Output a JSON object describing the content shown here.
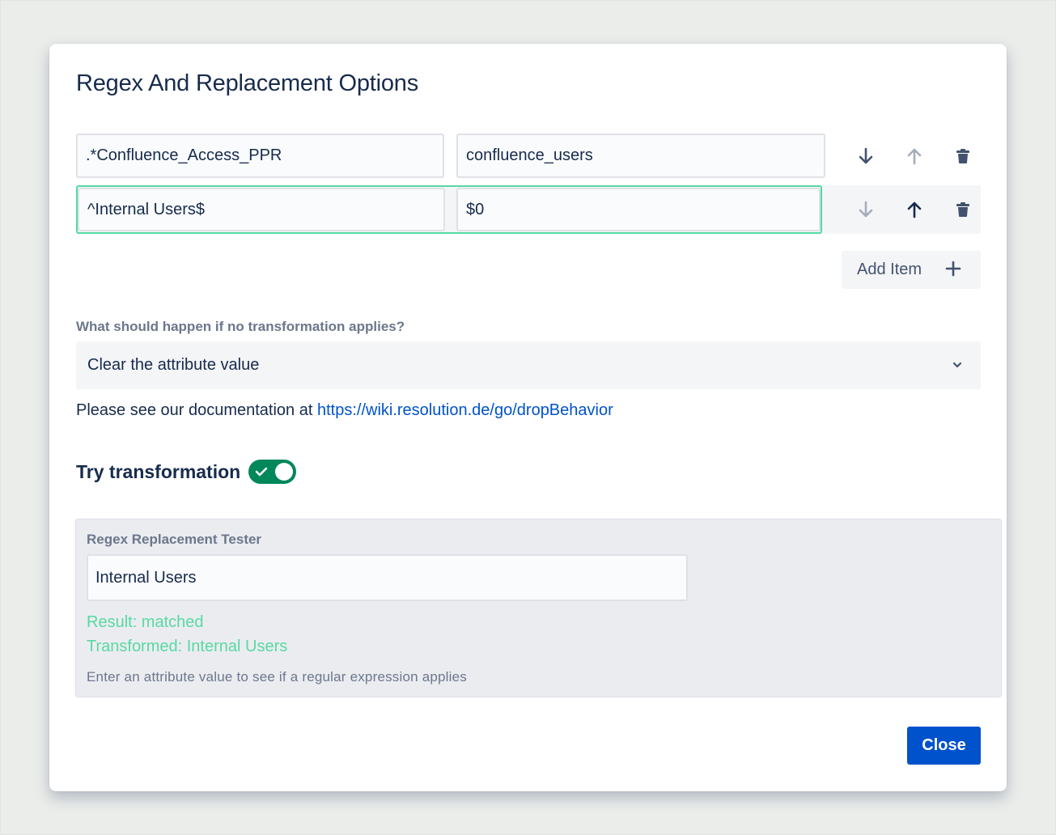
{
  "dialog": {
    "title": "Regex And Replacement Options"
  },
  "rules": [
    {
      "regex": ".*Confluence_Access_PPR",
      "replacement": "confluence_users",
      "down_enabled": true,
      "up_enabled": false
    },
    {
      "regex": "^Internal Users$",
      "replacement": "$0",
      "down_enabled": false,
      "up_enabled": true,
      "selected": true
    }
  ],
  "icons": {
    "move_down": "arrow-down-icon",
    "move_up": "arrow-up-icon",
    "delete": "trash-icon",
    "add": "plus-icon",
    "dropdown": "chevron-down-icon",
    "toggle_check": "check-icon"
  },
  "add_item_label": "Add Item",
  "no_transform": {
    "question": "What should happen if no transformation applies?",
    "selected": "Clear the attribute value"
  },
  "documentation": {
    "prefix": "Please see our documentation at",
    "link": "https://wiki.resolution.de/go/dropBehavior"
  },
  "try_transformation": {
    "label": "Try transformation",
    "enabled": true
  },
  "tester": {
    "label": "Regex Replacement Tester",
    "value": "Internal Users",
    "result": "Result: matched",
    "transformed": "Transformed: Internal Users",
    "hint": "Enter an attribute value to see if a regular expression applies"
  },
  "close_label": "Close",
  "colors": {
    "primary": "#0052cc",
    "success_text": "#57d9a3",
    "toggle_on": "#00875a",
    "selected_outline": "#57d9a3",
    "disabled_icon": "#a5adba",
    "enabled_icon": "#42526e"
  }
}
